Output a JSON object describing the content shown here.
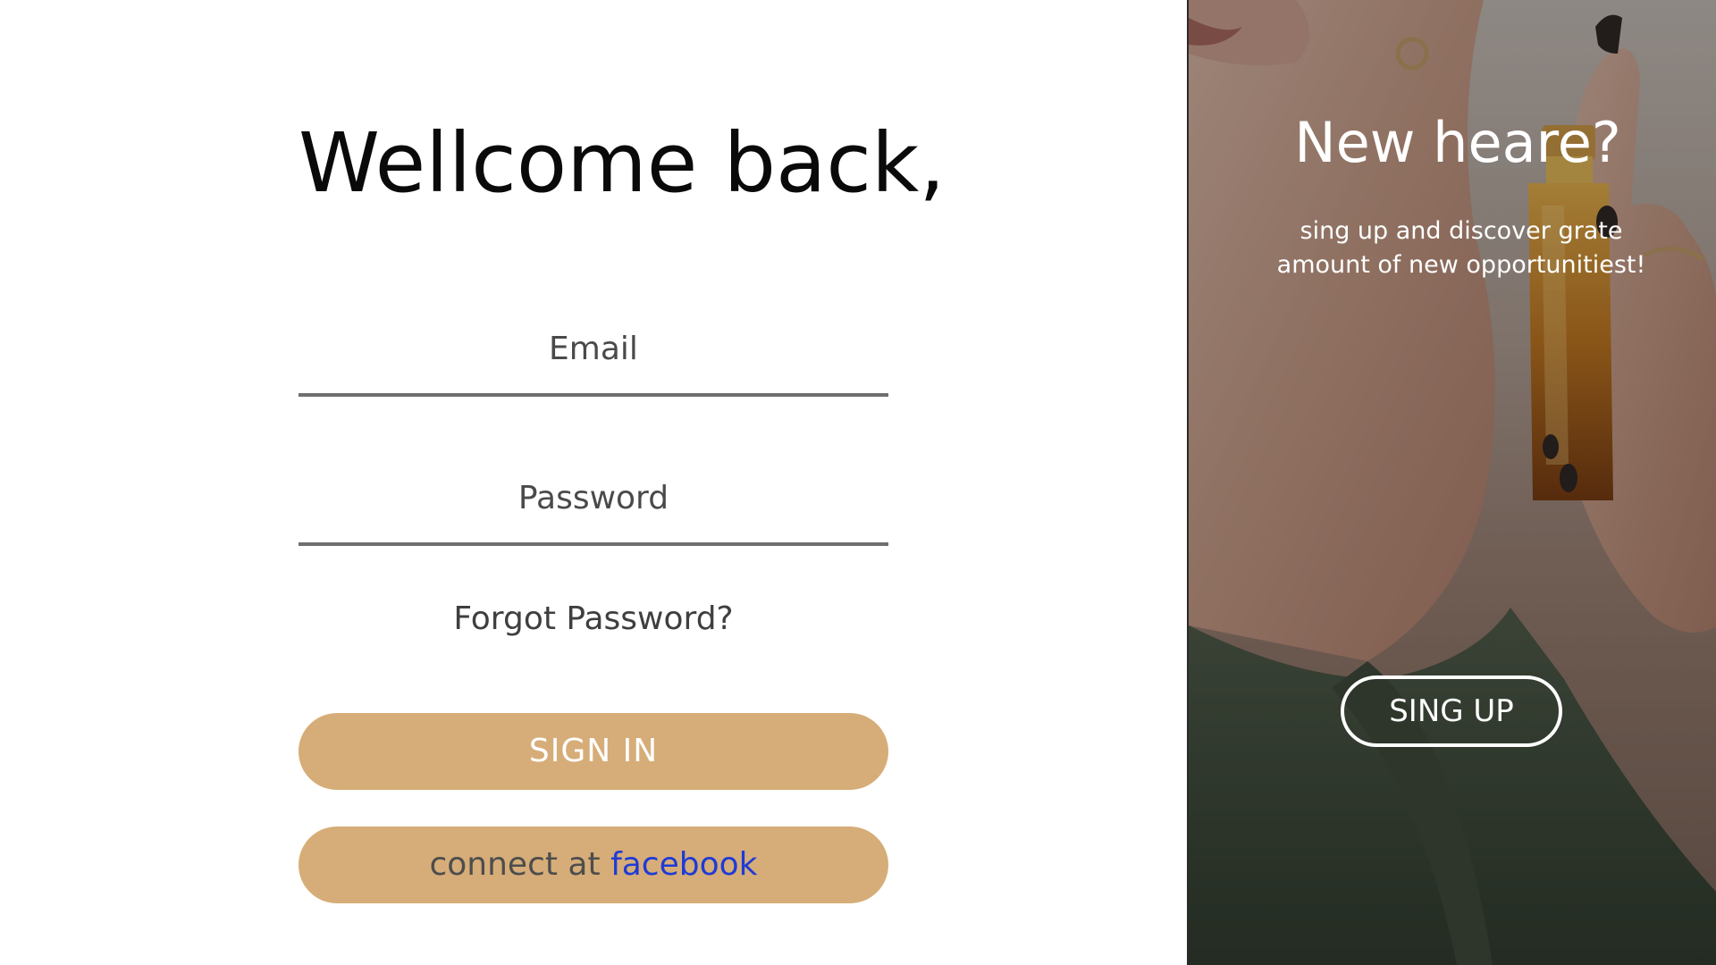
{
  "login": {
    "title": "Wellcome back,",
    "email_placeholder": "Email",
    "password_placeholder": "Password",
    "forgot_link": "Forgot Password?",
    "signin_label": "SIGN IN",
    "facebook_prefix": "connect at",
    "facebook_link": "facebook"
  },
  "promo": {
    "title": "New heare?",
    "text": "sing up  and  discover grate amount of new opportunitiest!",
    "signup_label": "SING UP",
    "photo": "woman-spraying-perfume-photo"
  },
  "colors": {
    "accent": "#d6ad78",
    "link": "#1f3bd6",
    "underline": "#6f6f6f",
    "title": "#0a0a0a"
  }
}
